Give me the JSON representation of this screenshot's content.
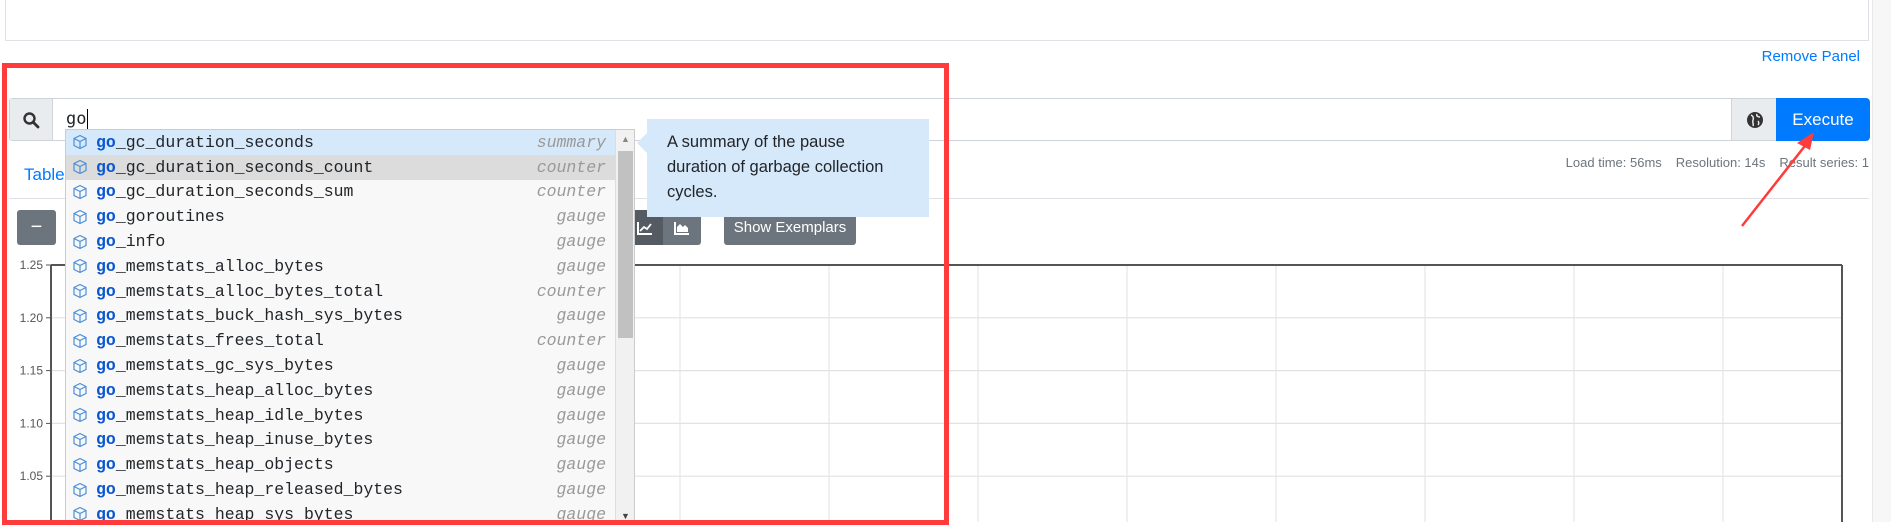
{
  "panel": {
    "remove_label": "Remove Panel"
  },
  "query": {
    "value": "go"
  },
  "execute_label": "Execute",
  "tabs": {
    "table": "Table"
  },
  "stats": {
    "load_time": "Load time: 56ms",
    "resolution": "Resolution: 14s",
    "result_series": "Result series: 1"
  },
  "graph_controls": {
    "minus": "−",
    "show_exemplars": "Show Exemplars"
  },
  "colors": {
    "accent": "#007bff",
    "highlight": "#d6e9fb",
    "annotation": "#ff3b3b",
    "match": "#0b57d0"
  },
  "autocomplete": {
    "match_prefix": "go",
    "items": [
      {
        "rest": "_gc_duration_seconds",
        "type": "summary"
      },
      {
        "rest": "_gc_duration_seconds_count",
        "type": "counter"
      },
      {
        "rest": "_gc_duration_seconds_sum",
        "type": "counter"
      },
      {
        "rest": "_goroutines",
        "type": "gauge"
      },
      {
        "rest": "_info",
        "type": "gauge"
      },
      {
        "rest": "_memstats_alloc_bytes",
        "type": "gauge"
      },
      {
        "rest": "_memstats_alloc_bytes_total",
        "type": "counter"
      },
      {
        "rest": "_memstats_buck_hash_sys_bytes",
        "type": "gauge"
      },
      {
        "rest": "_memstats_frees_total",
        "type": "counter"
      },
      {
        "rest": "_memstats_gc_sys_bytes",
        "type": "gauge"
      },
      {
        "rest": "_memstats_heap_alloc_bytes",
        "type": "gauge"
      },
      {
        "rest": "_memstats_heap_idle_bytes",
        "type": "gauge"
      },
      {
        "rest": "_memstats_heap_inuse_bytes",
        "type": "gauge"
      },
      {
        "rest": "_memstats_heap_objects",
        "type": "gauge"
      },
      {
        "rest": "_memstats_heap_released_bytes",
        "type": "gauge"
      },
      {
        "rest": "_memstats_heap_sys_bytes",
        "type": "gauge"
      }
    ],
    "tooltip": "A summary of the pause duration of garbage collection cycles."
  },
  "chart_data": {
    "type": "line",
    "ytick_labels": [
      "1.25",
      "1.20",
      "1.15",
      "1.10",
      "1.05"
    ],
    "grid": true,
    "series": []
  }
}
